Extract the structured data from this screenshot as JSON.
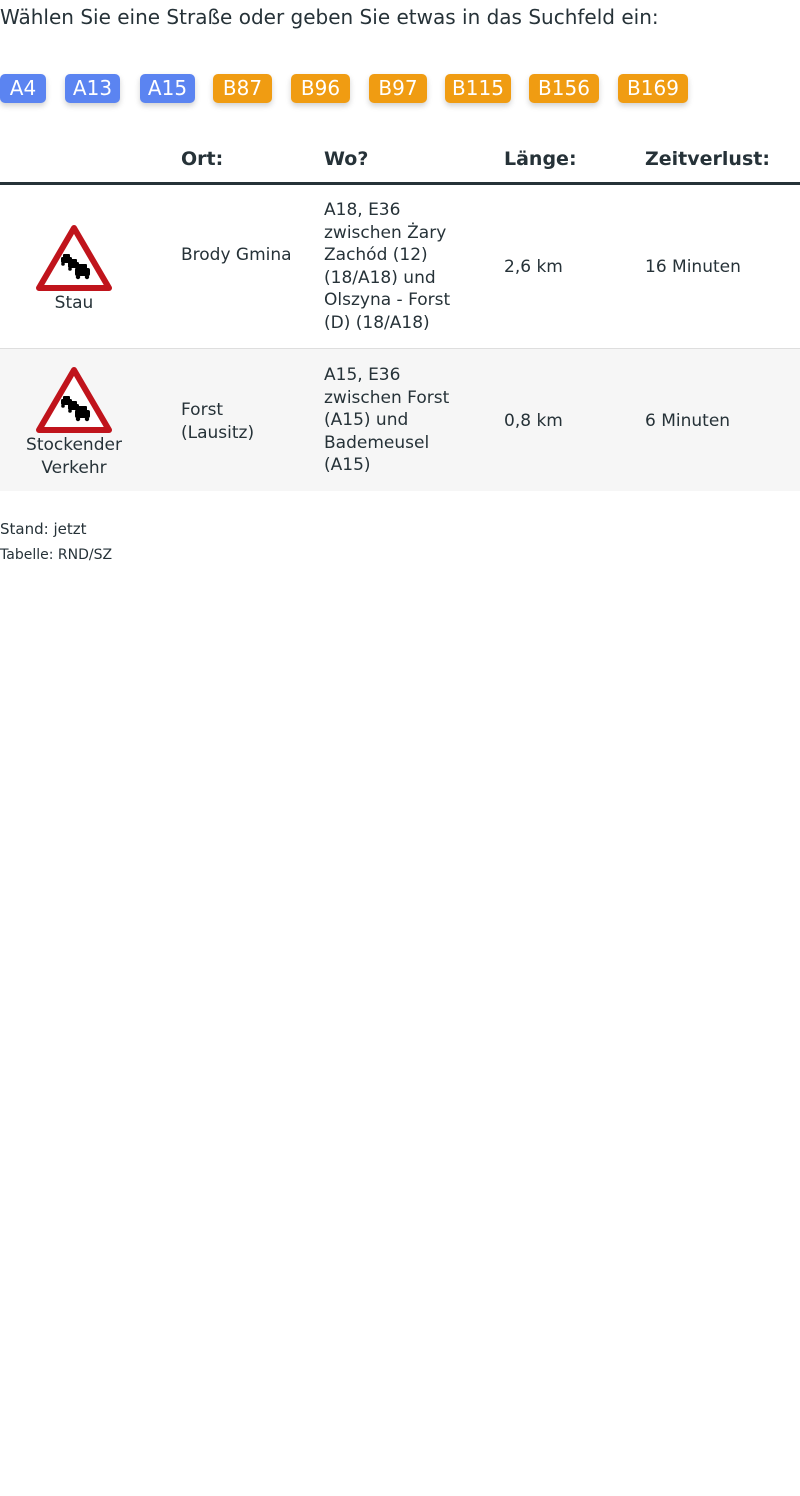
{
  "prompt": "Wählen Sie eine Straße oder geben Sie etwas in das Suchfeld ein:",
  "colors": {
    "autobahn": "#5b84f1",
    "bundesstrasse": "#f09c12",
    "text": "#263238",
    "sign_red": "#c0141c"
  },
  "roads": [
    {
      "label": "A4",
      "type": "autobahn"
    },
    {
      "label": "A13",
      "type": "autobahn"
    },
    {
      "label": "A15",
      "type": "autobahn"
    },
    {
      "label": "B87",
      "type": "bundesstrasse"
    },
    {
      "label": "B96",
      "type": "bundesstrasse"
    },
    {
      "label": "B97",
      "type": "bundesstrasse"
    },
    {
      "label": "B115",
      "type": "bundesstrasse"
    },
    {
      "label": "B156",
      "type": "bundesstrasse"
    },
    {
      "label": "B169",
      "type": "bundesstrasse"
    }
  ],
  "table": {
    "headers": {
      "ort": "Ort:",
      "wo": "Wo?",
      "laenge": "Länge:",
      "zeitverlust": "Zeitverlust:"
    },
    "rows": [
      {
        "icon": "traffic-jam-warning-icon",
        "type": "Stau",
        "ort": "Brody Gmina",
        "wo": "A18, E36 zwischen Żary Zachód (12) (18/A18) und Olszyna - Forst (D) (18/A18)",
        "laenge": "2,6 km",
        "zeitverlust": "16 Minuten"
      },
      {
        "icon": "traffic-jam-warning-icon",
        "type": "Stockender Verkehr",
        "ort": "Forst (Lausitz)",
        "wo": "A15, E36 zwischen Forst (A15) und Bademeusel (A15)",
        "laenge": "0,8 km",
        "zeitverlust": "6 Minuten"
      }
    ]
  },
  "footer": {
    "stand": "Stand: jetzt",
    "source": "Tabelle: RND/SZ"
  }
}
